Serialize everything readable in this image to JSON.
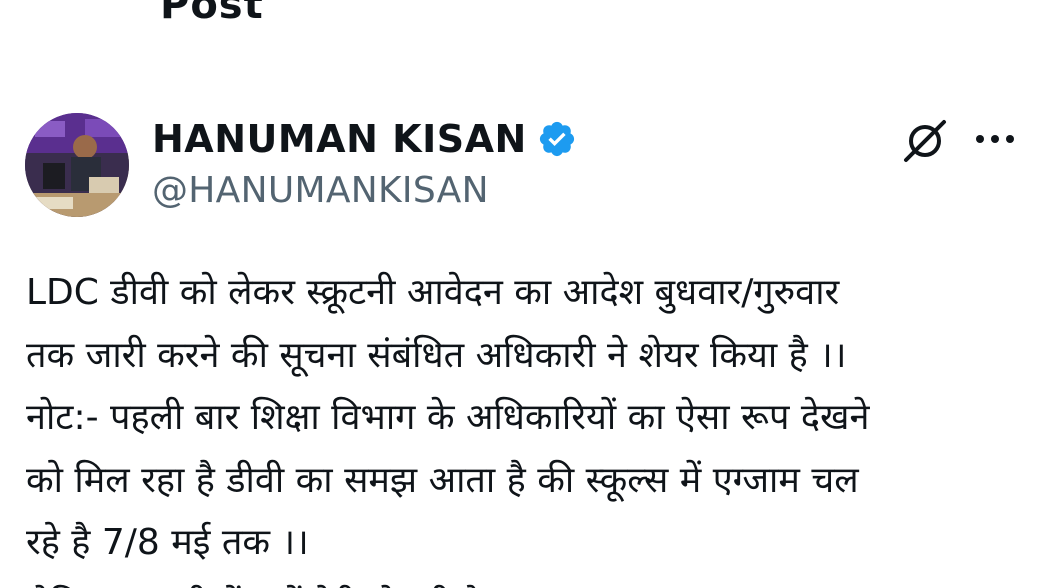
{
  "header": {
    "title": "Post"
  },
  "author": {
    "display_name": "HANUMAN KISAN",
    "handle": "@HANUMANKISAN",
    "verified": true,
    "verified_color": "#1d9bf0"
  },
  "actions": {
    "grok_icon": "grok-icon",
    "more_icon": "more-icon"
  },
  "tweet": {
    "lines": [
      "LDC डीवी को लेकर स्क्रूटनी आवेदन का आदेश बुधवार/गुरुवार",
      "तक जारी करने की सूचना संबंधित अधिकारी ने शेयर किया है ।।",
      "नोट:- पहली बार शिक्षा विभाग के अधिकारियों का ऐसा रूप देखने",
      "को मिल रहा है डीवी का समझ आता है की स्कूल्स में एग्जाम चल",
      "रहे है 7/8 मई तक ।।",
      "लेकिन स्क्रूटनी में क्यों देरी हो रही है"
    ]
  },
  "colors": {
    "text": "#0f1419",
    "secondary": "#536471"
  }
}
